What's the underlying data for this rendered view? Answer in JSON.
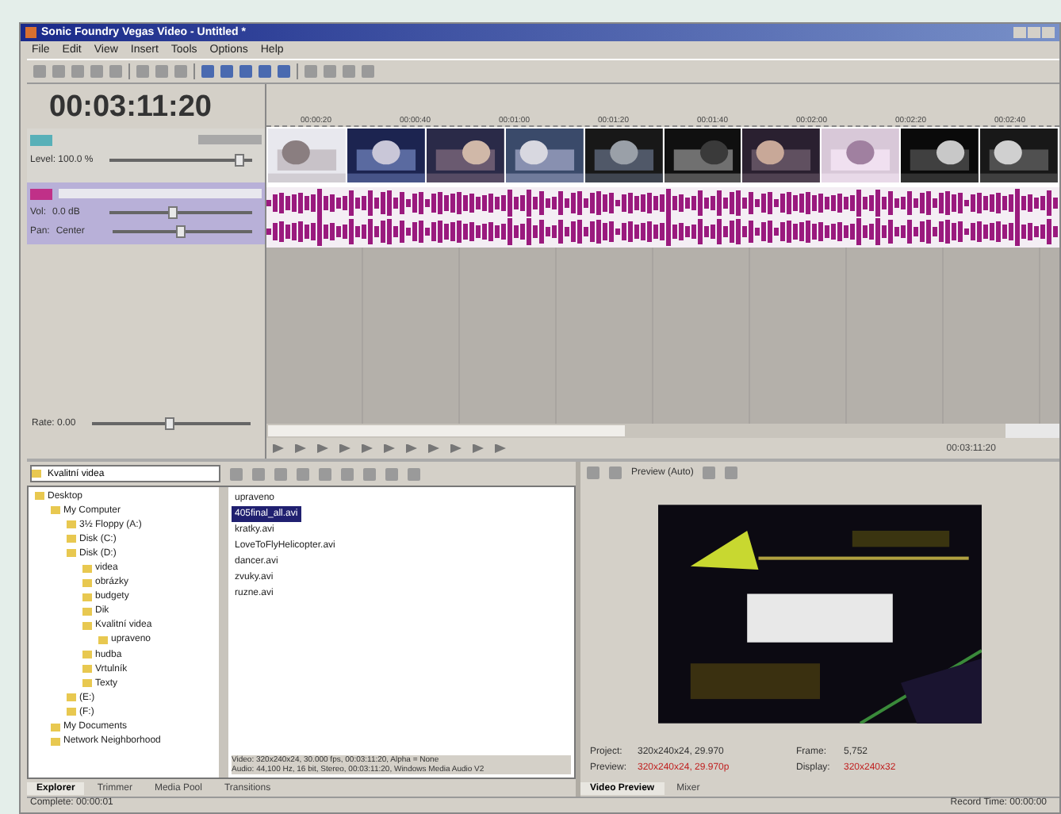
{
  "window": {
    "title": "Sonic Foundry Vegas Video - Untitled *"
  },
  "menu": [
    "File",
    "Edit",
    "View",
    "Insert",
    "Tools",
    "Options",
    "Help"
  ],
  "timecode": "00:03:11:20",
  "ruler": [
    "00:00:20",
    "00:00:40",
    "00:01:00",
    "00:01:20",
    "00:01:40",
    "00:02:00",
    "00:02:20",
    "00:02:40"
  ],
  "video_track": {
    "level_label": "Level: 100.0 %",
    "level": 0.92,
    "clips": [
      {
        "kind": "picture"
      },
      {
        "kind": "picture"
      },
      {
        "kind": "picture"
      },
      {
        "kind": "picture"
      },
      {
        "kind": "picture"
      },
      {
        "kind": "picture"
      },
      {
        "kind": "picture"
      },
      {
        "kind": "picture"
      },
      {
        "kind": "picture"
      },
      {
        "kind": "picture"
      }
    ]
  },
  "audio_track": {
    "sliders": [
      {
        "label": "Vol:",
        "reading": "0.0 dB",
        "level": 0.45
      },
      {
        "label": "Pan:",
        "reading": "Center",
        "level": 0.5
      }
    ]
  },
  "rate": {
    "label": "Rate: 0.00",
    "level": 0.5
  },
  "position": "00:03:11:20",
  "explorer": {
    "path": "Kvalitní videa",
    "tree": [
      {
        "label": "Desktop",
        "children": [
          {
            "label": "My Computer",
            "children": [
              {
                "label": "3½ Floppy (A:)"
              },
              {
                "label": "Disk (C:)"
              },
              {
                "label": "Disk (D:)",
                "children": [
                  {
                    "label": "videa"
                  },
                  {
                    "label": "obrázky"
                  },
                  {
                    "label": "budgety"
                  },
                  {
                    "label": "Dik"
                  },
                  {
                    "label": "Kvalitní videa",
                    "children": [
                      {
                        "label": "upraveno"
                      }
                    ]
                  },
                  {
                    "label": "hudba"
                  },
                  {
                    "label": "Vrtulník"
                  },
                  {
                    "label": "Texty"
                  }
                ]
              },
              {
                "label": "(E:)"
              },
              {
                "label": "(F:)"
              }
            ]
          },
          {
            "label": "My Documents"
          },
          {
            "label": "Network Neighborhood"
          }
        ]
      }
    ],
    "files": [
      {
        "name": "upraveno",
        "selected": false
      },
      {
        "name": "405final_all.avi",
        "selected": true
      },
      {
        "name": "kratky.avi",
        "selected": false
      },
      {
        "name": "LoveToFlyHelicopter.avi",
        "selected": false
      },
      {
        "name": "dancer.avi",
        "selected": false
      },
      {
        "name": "zvuky.avi",
        "selected": false
      },
      {
        "name": "ruzne.avi",
        "selected": false
      }
    ],
    "info": [
      "Video: 320x240x24, 30.000 fps, 00:03:11:20, Alpha = None",
      "Audio: 44,100 Hz, 16 bit, Stereo, 00:03:11:20, Windows Media Audio V2"
    ],
    "tabs": [
      {
        "label": "Explorer",
        "selected": true
      },
      {
        "label": "Trimmer",
        "selected": false
      },
      {
        "label": "Media Pool",
        "selected": false
      },
      {
        "label": "Transitions",
        "selected": false
      }
    ]
  },
  "preview": {
    "quality": "Preview (Auto)",
    "project_label": "Project:",
    "project": "320x240x24, 29.970",
    "preview_label": "Preview:",
    "preview": "320x240x24, 29.970p",
    "frame_label": "Frame:",
    "frame": "5,752",
    "display_label": "Display:",
    "display": "320x240x32",
    "tabs": [
      {
        "label": "Video Preview",
        "selected": true
      },
      {
        "label": "Mixer",
        "selected": false
      }
    ]
  },
  "status": "Complete: 00:00:01",
  "record_time": "Record Time: 00:00:00"
}
